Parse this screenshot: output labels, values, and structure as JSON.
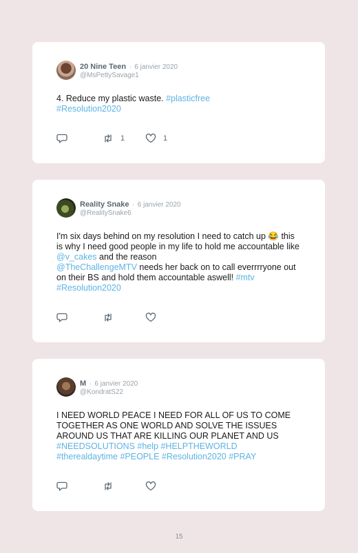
{
  "tweets": [
    {
      "name": "20 Nine Teen",
      "separator": "·",
      "date": "6 janvier 2020",
      "handle": "@MsPettySavage1",
      "text_plain": "4. Reduce my plastic waste. ",
      "link1": "#plasticfree",
      "link2": "#Resolution2020",
      "retweets": "1",
      "likes": "1"
    },
    {
      "name": "Reality Snake",
      "separator": "·",
      "date": "6 janvier 2020",
      "handle": "@RealitySnake6",
      "text_part1": "I'm six days behind on my resolution I need to catch up 😂 this is why I need good people in my life to hold me accountable like ",
      "mention1": "@v_cakes",
      "text_part2": " and the reason ",
      "mention2": "@TheChallengeMTV",
      "text_part3": " needs her back on to call everrrryone out on their BS and hold them accountable aswell! ",
      "tag1": "#mtv",
      "tag2": "#Resolution2020"
    },
    {
      "name": "M",
      "separator": "·",
      "date": "6 janvier 2020",
      "handle": "@KondratS22",
      "text_plain": "I NEED WORLD PEACE I NEED FOR ALL OF US TO COME TOGETHER AS ONE WORLD AND SOLVE THE ISSUES AROUND US THAT ARE KILLING OUR PLANET AND US ",
      "tag1": "#NEEDSOLUTIONS",
      "tag2": "#help",
      "tag3": "#HELPTHEWORLD",
      "tag4": "#therealdaytime",
      "tag5": "#PEOPLE",
      "tag6": "#Resolution2020",
      "tag7": "#PRAY"
    }
  ],
  "icons": {
    "reply": "comment-icon",
    "retweet": "retweet-icon",
    "like": "heart-icon"
  },
  "colors": {
    "link": "#5db3e3",
    "background": "#efe5e7",
    "card": "#ffffff"
  },
  "page_number": "15"
}
